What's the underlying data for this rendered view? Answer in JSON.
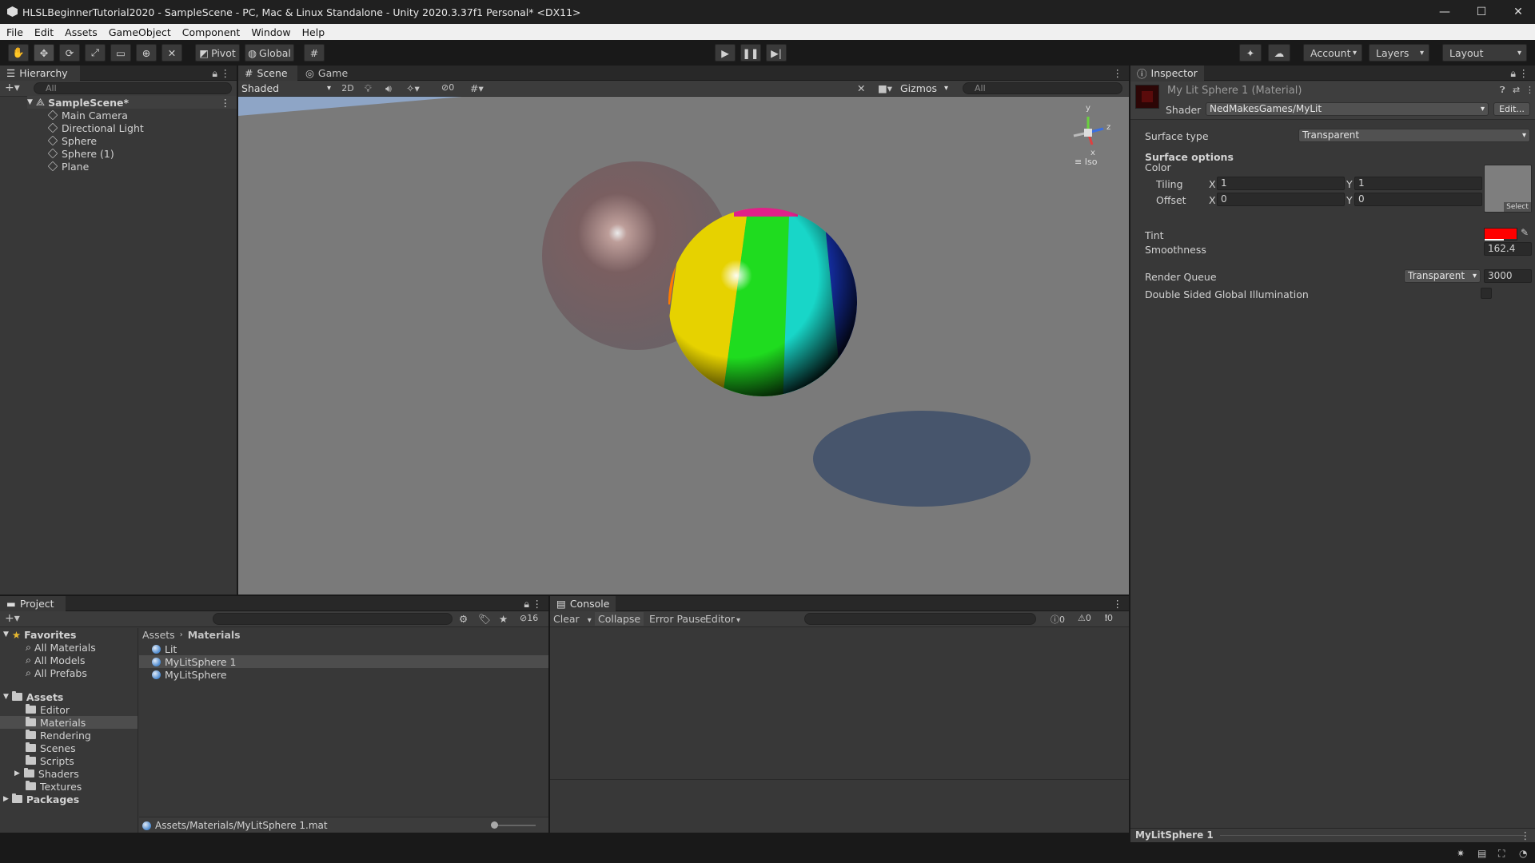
{
  "window": {
    "title": "HLSLBeginnerTutorial2020 - SampleScene - PC, Mac & Linux Standalone - Unity 2020.3.37f1 Personal* <DX11>"
  },
  "menu": [
    "File",
    "Edit",
    "Assets",
    "GameObject",
    "Component",
    "Window",
    "Help"
  ],
  "toolbar": {
    "pivot": "Pivot",
    "global": "Global",
    "account": "Account",
    "layers": "Layers",
    "layout": "Layout"
  },
  "hierarchy": {
    "tab": "Hierarchy",
    "search": "All",
    "scene": "SampleScene*",
    "items": [
      "Main Camera",
      "Directional Light",
      "Sphere",
      "Sphere (1)",
      "Plane"
    ]
  },
  "scene": {
    "tabs": [
      "Scene",
      "Game"
    ],
    "draw_mode": "Shaded",
    "mode_2d": "2D",
    "hidden_count": "0",
    "gizmos": "Gizmos",
    "search": "All",
    "gizmo_axes": {
      "x": "x",
      "y": "y",
      "z": "z"
    },
    "projection": "Iso"
  },
  "inspector": {
    "tab": "Inspector",
    "title": "My Lit Sphere 1 (Material)",
    "shader_label": "Shader",
    "shader": "NedMakesGames/MyLit",
    "edit": "Edit...",
    "surface_type_label": "Surface type",
    "surface_type": "Transparent",
    "surface_options": "Surface options",
    "color_label": "Color",
    "tiling_label": "Tiling",
    "offset_label": "Offset",
    "x": "X",
    "y": "Y",
    "tiling_x": "1",
    "tiling_y": "1",
    "offset_x": "0",
    "offset_y": "0",
    "select": "Select",
    "tint_label": "Tint",
    "tint_color": "#ff0000",
    "smoothness_label": "Smoothness",
    "smoothness": "162.4",
    "render_queue_label": "Render Queue",
    "render_queue_mode": "Transparent",
    "render_queue": "3000",
    "double_sided_label": "Double Sided Global Illumination",
    "preview_name": "MyLitSphere 1"
  },
  "project": {
    "tab": "Project",
    "hidden_count": "16",
    "favorites": {
      "label": "Favorites",
      "items": [
        "All Materials",
        "All Models",
        "All Prefabs"
      ]
    },
    "assets": {
      "label": "Assets",
      "items": [
        "Editor",
        "Materials",
        "Rendering",
        "Scenes",
        "Scripts",
        "Shaders",
        "Textures"
      ]
    },
    "packages": "Packages",
    "breadcrumb": [
      "Assets",
      "Materials"
    ],
    "files": [
      "Lit",
      "MyLitSphere 1",
      "MyLitSphere"
    ],
    "selected_path": "Assets/Materials/MyLitSphere 1.mat"
  },
  "console": {
    "tab": "Console",
    "clear": "Clear",
    "collapse": "Collapse",
    "error_pause": "Error Pause",
    "editor": "Editor",
    "info_count": "0",
    "warn_count": "0",
    "error_count": "0"
  }
}
